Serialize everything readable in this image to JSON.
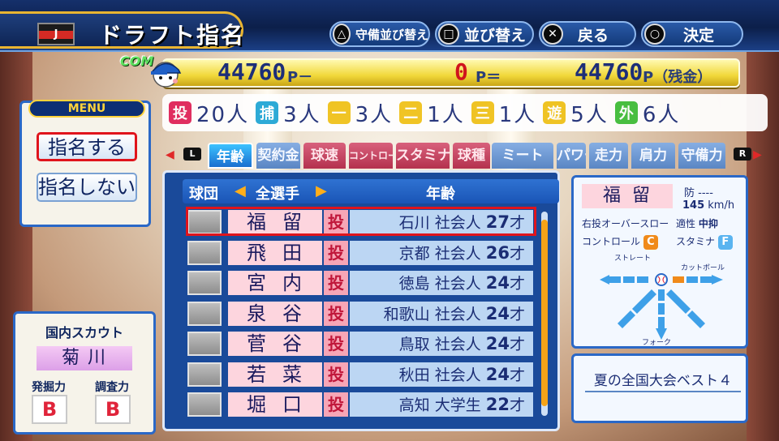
{
  "header": {
    "title": "ドラフト指名",
    "team_logo_letter": "J",
    "controls": [
      {
        "icon": "triangle-button-icon",
        "glyph": "△",
        "label": "守備並び替え"
      },
      {
        "icon": "square-button-icon",
        "glyph": "□",
        "label": "並び替え"
      },
      {
        "icon": "cross-button-icon",
        "glyph": "✕",
        "label": "戻る"
      },
      {
        "icon": "circle-button-icon",
        "glyph": "○",
        "label": "決定"
      }
    ]
  },
  "points": {
    "com_tag": "COM",
    "left_value": "44760",
    "left_unit": "P－",
    "middle_value": "0",
    "middle_unit": "P＝",
    "right_value": "44760",
    "right_unit": "P（残金）"
  },
  "position_counts": [
    {
      "pos": "投",
      "count": "20人",
      "color": "#e0245a"
    },
    {
      "pos": "捕",
      "count": "3人",
      "color": "#21a6d6"
    },
    {
      "pos": "一",
      "count": "3人",
      "color": "#f0c21a"
    },
    {
      "pos": "二",
      "count": "1人",
      "color": "#f0c21a"
    },
    {
      "pos": "三",
      "count": "1人",
      "color": "#f0c21a"
    },
    {
      "pos": "遊",
      "count": "5人",
      "color": "#f0c21a"
    },
    {
      "pos": "外",
      "count": "6人",
      "color": "#3fbe3a"
    }
  ],
  "menu": {
    "header": "MENU",
    "items": [
      "指名する",
      "指名しない"
    ],
    "selected_index": 0
  },
  "tabs": {
    "l_button": "L",
    "r_button": "R",
    "items": [
      {
        "label": "年齢",
        "style": "active"
      },
      {
        "label": "契約金",
        "style": "blue"
      },
      {
        "label": "球速",
        "style": "red"
      },
      {
        "label": "コントロール",
        "style": "red"
      },
      {
        "label": "スタミナ",
        "style": "red"
      },
      {
        "label": "球種",
        "style": "red"
      },
      {
        "label": "ミート",
        "style": "blue"
      },
      {
        "label": "パワー",
        "style": "blue"
      },
      {
        "label": "走力",
        "style": "blue"
      },
      {
        "label": "肩力",
        "style": "blue"
      },
      {
        "label": "守備力",
        "style": "blue"
      }
    ]
  },
  "list": {
    "col_team": "球団",
    "filter": "全選手",
    "col_sort": "年齢",
    "selected_index": 0,
    "rows": [
      {
        "name": "福留",
        "pos": "投",
        "origin": "石川",
        "type": "社会人",
        "age": "27",
        "age_unit": "才"
      },
      {
        "name": "飛田",
        "pos": "投",
        "origin": "京都",
        "type": "社会人",
        "age": "26",
        "age_unit": "才"
      },
      {
        "name": "宮内",
        "pos": "投",
        "origin": "徳島",
        "type": "社会人",
        "age": "24",
        "age_unit": "才"
      },
      {
        "name": "泉谷",
        "pos": "投",
        "origin": "和歌山",
        "type": "社会人",
        "age": "24",
        "age_unit": "才"
      },
      {
        "name": "菅谷",
        "pos": "投",
        "origin": "鳥取",
        "type": "社会人",
        "age": "24",
        "age_unit": "才"
      },
      {
        "name": "若菜",
        "pos": "投",
        "origin": "秋田",
        "type": "社会人",
        "age": "24",
        "age_unit": "才"
      },
      {
        "name": "堀口",
        "pos": "投",
        "origin": "高知",
        "type": "大学生",
        "age": "22",
        "age_unit": "才"
      }
    ]
  },
  "player": {
    "name": "福留",
    "era_label": "防",
    "era_value": "----",
    "speed": "145",
    "speed_unit": "km/h",
    "form": "右投オーバースロー",
    "aptitude_label": "適性",
    "aptitude": "中抑",
    "control_label": "コントロール",
    "control_grade": "C",
    "control_color": "#f08a1a",
    "stamina_label": "スタミナ",
    "stamina_grade": "F",
    "stamina_color": "#5ab4f0",
    "pitch_top": "ストレート",
    "pitch_right": "カットボール",
    "pitch_bottom": "フォーク"
  },
  "trait": "夏の全国大会ベスト４",
  "scout": {
    "title": "国内スカウト",
    "name": "菊川",
    "skill1_label": "発掘力",
    "skill1_grade": "B",
    "skill2_label": "調査力",
    "skill2_grade": "B"
  }
}
